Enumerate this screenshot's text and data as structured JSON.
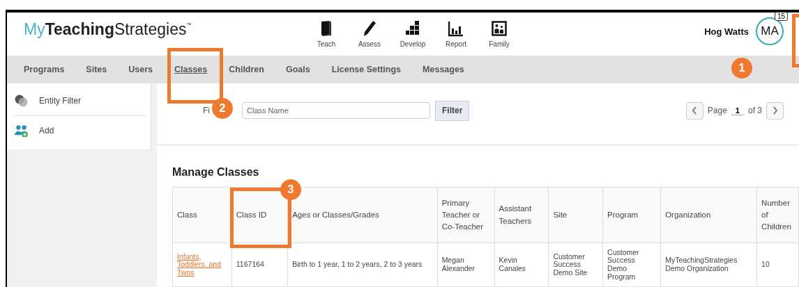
{
  "logo": {
    "light": "My",
    "bold": "Teaching",
    "rest": "Strategies",
    "mark": "™"
  },
  "apps": [
    {
      "label": "Teach",
      "kind": "book"
    },
    {
      "label": "Assess",
      "kind": "pencil"
    },
    {
      "label": "Develop",
      "kind": "blocks"
    },
    {
      "label": "Report",
      "kind": "chart"
    },
    {
      "label": "Family",
      "kind": "family"
    }
  ],
  "user": {
    "name": "Hog Watts",
    "initials": "MA",
    "badge": "15"
  },
  "nav": [
    {
      "label": "Programs",
      "selected": false
    },
    {
      "label": "Sites",
      "selected": false
    },
    {
      "label": "Users",
      "selected": false
    },
    {
      "label": "Classes",
      "selected": true
    },
    {
      "label": "Children",
      "selected": false
    },
    {
      "label": "Goals",
      "selected": false
    },
    {
      "label": "License Settings",
      "selected": false
    },
    {
      "label": "Messages",
      "selected": false
    }
  ],
  "sidebar": {
    "items": [
      {
        "label": "Entity Filter",
        "kind": "filter"
      },
      {
        "label": "Add",
        "kind": "add"
      }
    ]
  },
  "filter": {
    "label": "Fi",
    "placeholder": "Class Name",
    "button": "Filter"
  },
  "pager": {
    "label": "Page",
    "page": "1",
    "of": "of 3"
  },
  "heading": "Manage Classes",
  "table": {
    "columns": [
      "Class",
      "Class ID",
      "Ages or Classes/Grades",
      "Primary Teacher or Co-Teacher",
      "Assistant Teachers",
      "Site",
      "Program",
      "Organization",
      "Number of Children"
    ],
    "rows": [
      [
        "Infants, Toddlers, and Twos",
        "1167164",
        "Birth to 1 year, 1 to 2 years, 2 to 3 years",
        "Megan Alexander",
        "Kevin Canales",
        "Customer Success Demo Site",
        "Customer Success Demo Program",
        "MyTeachingStrategies Demo Organization",
        "10"
      ]
    ]
  },
  "callouts": [
    "1",
    "2",
    "3"
  ]
}
